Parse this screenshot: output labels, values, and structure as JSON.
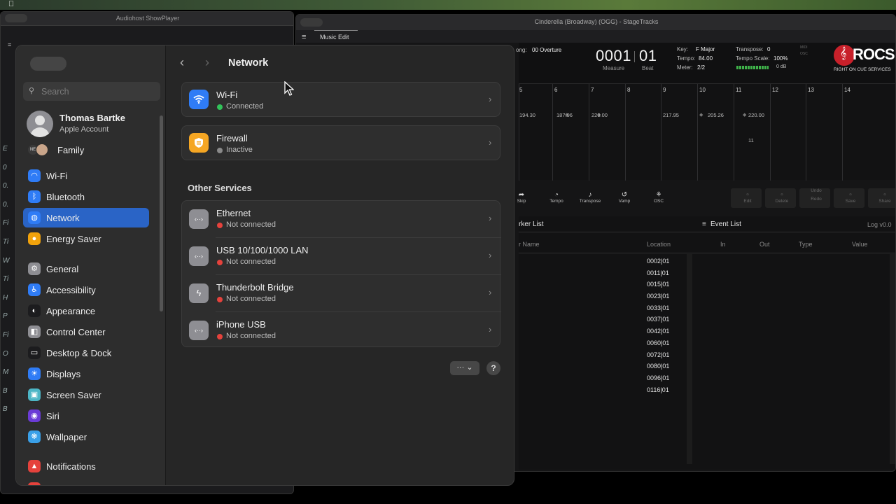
{
  "menubar": {
    "apple_icon": "apple-logo-icon"
  },
  "showplayer": {
    "title": "Audiohost ShowPlayer",
    "side_letters": [
      "E",
      "0",
      "0.",
      "0.",
      "Fi",
      "Ti",
      "W",
      "Ti",
      "H",
      "P",
      "Fi",
      "O",
      "M",
      "B",
      "B"
    ]
  },
  "stagetracks": {
    "title": "Cinderella (Broadway) (OGG) - StageTracks",
    "tab": "Music Edit",
    "song_label": "ong:",
    "song_value": "00 Overture",
    "measure": "0001",
    "measure_label": "Measure",
    "beat": "01",
    "beat_label": "Beat",
    "key_label": "Key:",
    "key_value": "F Major",
    "tempo_label": "Tempo:",
    "tempo_value": "84.00",
    "meter_label": "Meter:",
    "meter_value": "2/2",
    "transpose_label": "Transpose:",
    "transpose_value": "0",
    "tempo_scale_label": "Tempo Scale:",
    "tempo_scale_value": "100%",
    "db_value": "0 dB",
    "midi": "MIDI",
    "osc_ind": "OSC",
    "logo_text": "ROCS",
    "logo_sub": "RIGHT ON CUE SERVICES",
    "bars": [
      "5",
      "6",
      "7",
      "8",
      "9",
      "10",
      "11",
      "12",
      "13",
      "14"
    ],
    "tempos": [
      "194.30",
      "187.96",
      "220.00",
      "217.95",
      "205.26",
      "220.00"
    ],
    "marker_11": "11",
    "tools": [
      {
        "label": "Skip",
        "icon": "skip-icon"
      },
      {
        "label": "Tempo",
        "icon": "tempo-icon"
      },
      {
        "label": "Transpose",
        "icon": "transpose-icon"
      },
      {
        "label": "Vamp",
        "icon": "vamp-icon"
      },
      {
        "label": "OSC",
        "icon": "osc-icon"
      }
    ],
    "tools_right": [
      "Edit",
      "Delete",
      "Undo",
      "Redo",
      "Save",
      "Share"
    ],
    "marker_list_title": "rker List",
    "marker_col_name": "r Name",
    "marker_col_location": "Location",
    "locations": [
      "0002|01",
      "0011|01",
      "0015|01",
      "0023|01",
      "0033|01",
      "0037|01",
      "0042|01",
      "0060|01",
      "0072|01",
      "0080|01",
      "0096|01",
      "0116|01"
    ],
    "event_list_title": "Event List",
    "log_version": "Log v0.0",
    "event_cols": [
      "In",
      "Out",
      "Type",
      "Value"
    ]
  },
  "settings": {
    "search_placeholder": "Search",
    "user_name": "Thomas Bartke",
    "user_sub": "Apple Account",
    "family_label": "Family",
    "family_badge": "NE",
    "sidebar_items": [
      {
        "label": "Wi-Fi",
        "icon": "wifi-icon",
        "color": "#2f7cf6"
      },
      {
        "label": "Bluetooth",
        "icon": "bluetooth-icon",
        "color": "#2f7cf6"
      },
      {
        "label": "Network",
        "icon": "globe-icon",
        "color": "#2f7cf6"
      },
      {
        "label": "Energy Saver",
        "icon": "lightbulb-icon",
        "color": "#f1a20b"
      },
      {
        "label": "General",
        "icon": "gear-icon",
        "color": "#8e8e93"
      },
      {
        "label": "Accessibility",
        "icon": "accessibility-icon",
        "color": "#2f7cf6"
      },
      {
        "label": "Appearance",
        "icon": "appearance-icon",
        "color": "#1c1c1e"
      },
      {
        "label": "Control Center",
        "icon": "control-center-icon",
        "color": "#8e8e93"
      },
      {
        "label": "Desktop & Dock",
        "icon": "dock-icon",
        "color": "#1c1c1e"
      },
      {
        "label": "Displays",
        "icon": "sun-icon",
        "color": "#2f7cf6"
      },
      {
        "label": "Screen Saver",
        "icon": "screen-saver-icon",
        "color": "#4db6c6"
      },
      {
        "label": "Siri",
        "icon": "siri-icon",
        "color": "#6b3bd6"
      },
      {
        "label": "Wallpaper",
        "icon": "wallpaper-icon",
        "color": "#3aa0e8"
      },
      {
        "label": "Notifications",
        "icon": "bell-icon",
        "color": "#e5423c"
      }
    ],
    "title": "Network",
    "wifi": {
      "title": "Wi-Fi",
      "status": "Connected",
      "status_color": "#32c35a",
      "icon": "wifi-icon"
    },
    "firewall": {
      "title": "Firewall",
      "status": "Inactive",
      "status_color": "#8a8a8a",
      "icon": "firewall-icon"
    },
    "section_label": "Other Services",
    "services": [
      {
        "title": "Ethernet",
        "status": "Not connected",
        "icon": "ethernet-icon"
      },
      {
        "title": "USB 10/100/1000 LAN",
        "status": "Not connected",
        "icon": "ethernet-icon"
      },
      {
        "title": "Thunderbolt Bridge",
        "status": "Not connected",
        "icon": "thunderbolt-icon"
      },
      {
        "title": "iPhone USB",
        "status": "Not connected",
        "icon": "ethernet-icon"
      }
    ],
    "not_connected_color": "#e5423c",
    "more_button": "··· ⌄",
    "help_button": "?"
  }
}
